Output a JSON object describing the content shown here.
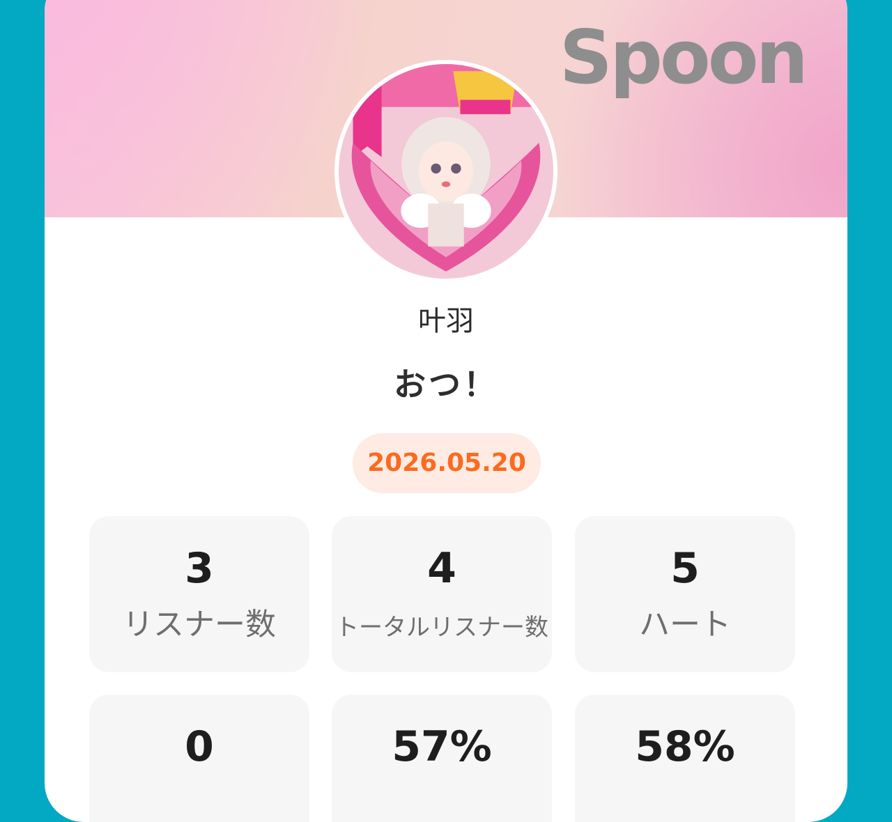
{
  "brand": {
    "name": "Spoon"
  },
  "profile": {
    "user_name": "叶羽",
    "title": "おつ！",
    "date": "2026.05.20"
  },
  "stats": [
    {
      "value": "3",
      "label": "リスナー数"
    },
    {
      "value": "4",
      "label": "トータルリスナー数"
    },
    {
      "value": "5",
      "label": "ハート"
    },
    {
      "value": "0",
      "label": ""
    },
    {
      "value": "57%",
      "label": ""
    },
    {
      "value": "58%",
      "label": ""
    }
  ],
  "colors": {
    "background": "#03a8c2",
    "date_text": "#fc6a1f",
    "date_bg": "#feebe3",
    "brand": "#8e8e8e"
  }
}
